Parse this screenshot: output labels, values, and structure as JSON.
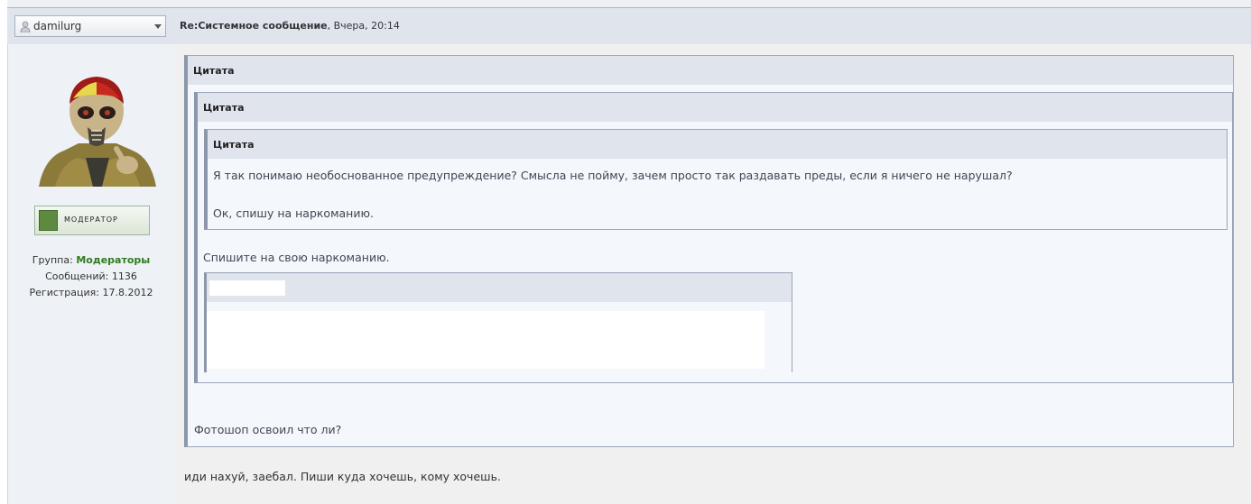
{
  "header": {
    "username": "damilurg",
    "post_subject": "Re:Системное сообщение",
    "post_date": ", Вчера, 20:14"
  },
  "profile": {
    "rank_badge": "Модератор",
    "group_label": "Группа: ",
    "group_value": "Модераторы",
    "posts": "Сообщений: 1136",
    "registered": "Регистрация: 17.8.2012"
  },
  "quotes": {
    "outer": {
      "label": "Цитата",
      "after_text": "Фотошоп освоил что ли?"
    },
    "middle": {
      "label": "Цитата",
      "after_text": "Спишите на свою наркоманию."
    },
    "inner": {
      "label": "Цитата",
      "line1": "Я так понимаю необоснованное предупреждение? Смысла не пойму, зачем просто так раздавать преды, если я ничего не нарушал?",
      "line2": "Ок, спишу на наркоманию."
    }
  },
  "post_text": "иди нахуй, заебал. Пиши куда хочешь, кому хочешь.",
  "icons": {
    "user": "user-icon",
    "dropdown": "chevron-down-icon",
    "avatar": "avatar-image",
    "rank": "moderator-badge-icon"
  },
  "colors": {
    "header_bg": "#dfe4ed",
    "quote_border": "#8c97ab",
    "group_green": "#2e7d1f",
    "content_bg": "#f0f0f0"
  }
}
